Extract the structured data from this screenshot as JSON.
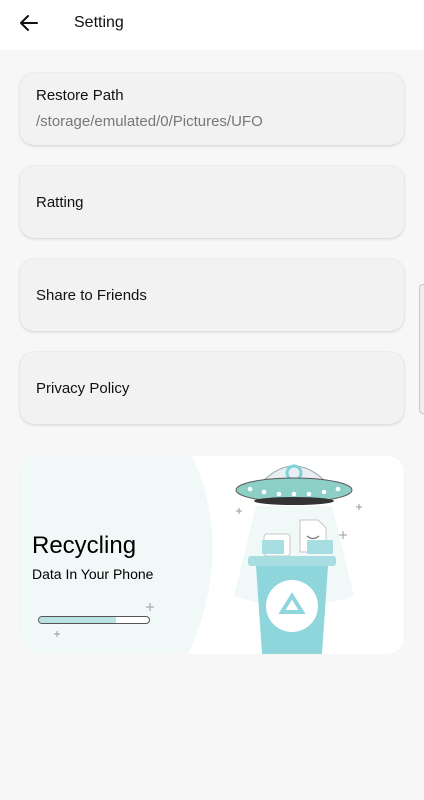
{
  "header": {
    "title": "Setting",
    "back_icon": "arrow-left-icon"
  },
  "settings": {
    "restore": {
      "label": "Restore Path",
      "value": "/storage/emulated/0/Pictures/UFO"
    },
    "rating": {
      "label": "Ratting"
    },
    "share": {
      "label": "Share to Friends"
    },
    "privacy": {
      "label": "Privacy Policy"
    }
  },
  "banner": {
    "title": "Recycling",
    "subtitle": "Data In Your Phone",
    "progress": 0.7,
    "illustration": "ufo-recycle-bin-illustration",
    "accent_color": "#8fd6dc"
  }
}
